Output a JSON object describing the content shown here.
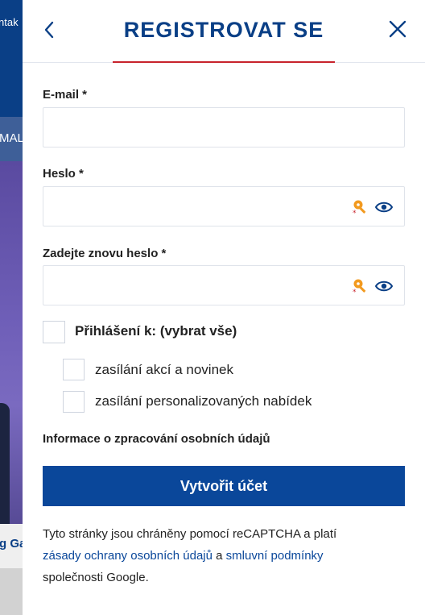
{
  "background": {
    "top_text": "ntak",
    "strip_text": "MAL",
    "caption_text": "g Ga"
  },
  "header": {
    "title": "REGISTROVAT SE"
  },
  "form": {
    "email_label": "E-mail *",
    "email_value": "",
    "password_label": "Heslo *",
    "password_value": "",
    "password_repeat_label": "Zadejte znovu heslo *",
    "password_repeat_value": ""
  },
  "subscriptions": {
    "all_label": "Přihlášení k: (vybrat vše)",
    "items": [
      {
        "label": "zasílání akcí a novinek",
        "checked": false
      },
      {
        "label": "zasílání personalizovaných nabídek",
        "checked": false
      }
    ]
  },
  "info_link": "Informace o zpracování osobních údajů",
  "submit_label": "Vytvořit účet",
  "recaptcha": {
    "prefix": "Tyto stránky jsou chráněny pomocí reCAPTCHA a platí",
    "privacy_link": "zásady ochrany osobních údajů",
    "and": " a ",
    "terms_link": "smluvní podmínky",
    "suffix": "společnosti Google."
  },
  "colors": {
    "brand": "#0a3f86",
    "button": "#0a479a",
    "accent": "#c8232c"
  },
  "icons": {
    "back": "chevron-left-icon",
    "close": "close-icon",
    "password_key": "key-icon",
    "show_password": "eye-icon"
  }
}
